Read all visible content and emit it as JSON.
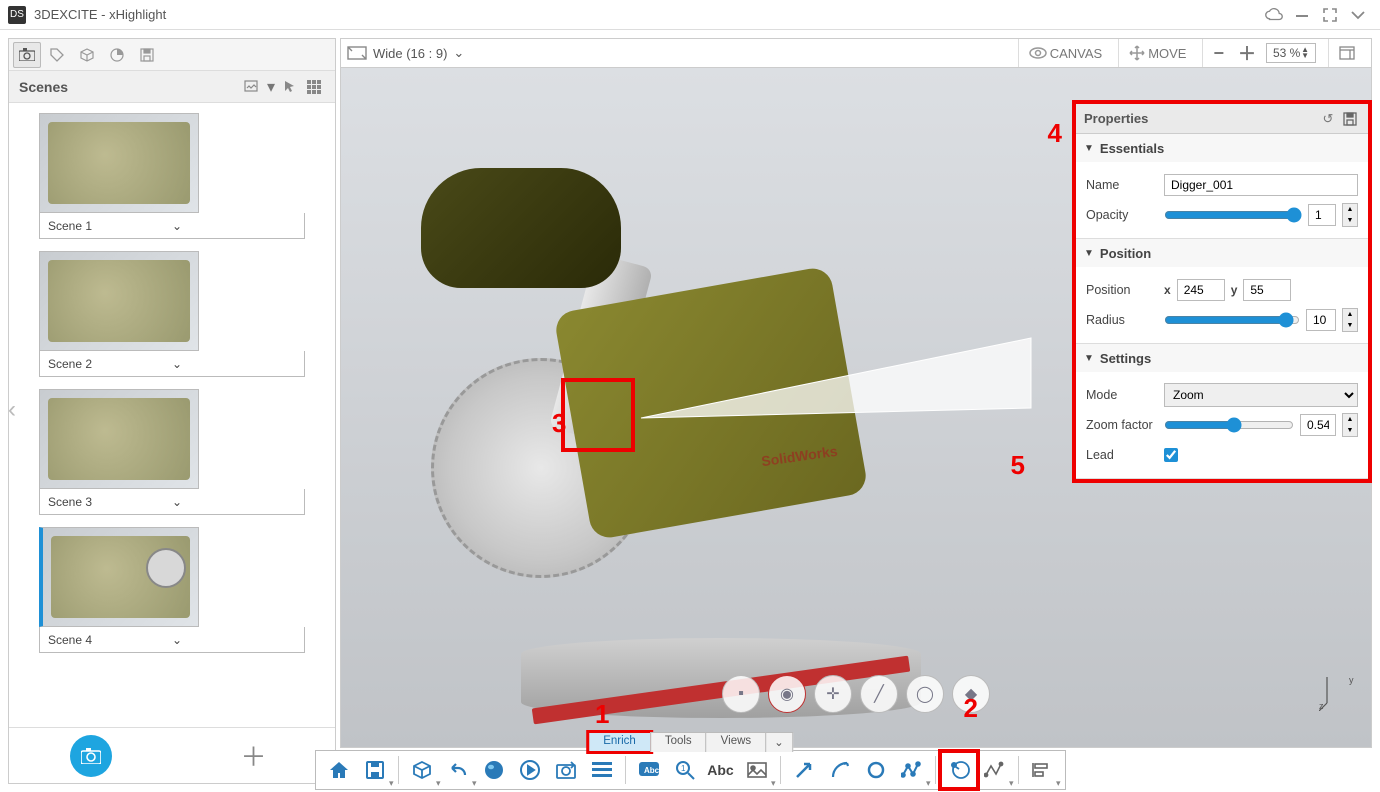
{
  "app": {
    "title": "3DEXCITE - xHighlight"
  },
  "sidebar": {
    "title": "Scenes",
    "items": [
      {
        "label": "Scene 1"
      },
      {
        "label": "Scene 2"
      },
      {
        "label": "Scene 3"
      },
      {
        "label": "Scene 4"
      }
    ]
  },
  "canvasBar": {
    "aspect": "Wide (16 : 9)",
    "canvasLabel": "CANVAS",
    "moveLabel": "MOVE",
    "zoom": "53 %"
  },
  "viewport": {
    "brand": "SolidWorks"
  },
  "properties": {
    "title": "Properties",
    "sections": {
      "essentials": {
        "title": "Essentials",
        "nameLabel": "Name",
        "name": "Digger_001",
        "opacityLabel": "Opacity",
        "opacity": "1"
      },
      "position": {
        "title": "Position",
        "posLabel": "Position",
        "xLabel": "x",
        "x": "245",
        "yLabel": "y",
        "y": "55",
        "radiusLabel": "Radius",
        "radius": "10"
      },
      "settings": {
        "title": "Settings",
        "modeLabel": "Mode",
        "mode": "Zoom",
        "zoomFactorLabel": "Zoom factor",
        "zoomFactor": "0.54",
        "leadLabel": "Lead",
        "lead": true
      }
    }
  },
  "bottomTabs": {
    "enrich": "Enrich",
    "tools": "Tools",
    "views": "Views"
  },
  "annotations": {
    "n1": "1",
    "n2": "2",
    "n3": "3",
    "n4": "4",
    "n5": "5"
  }
}
